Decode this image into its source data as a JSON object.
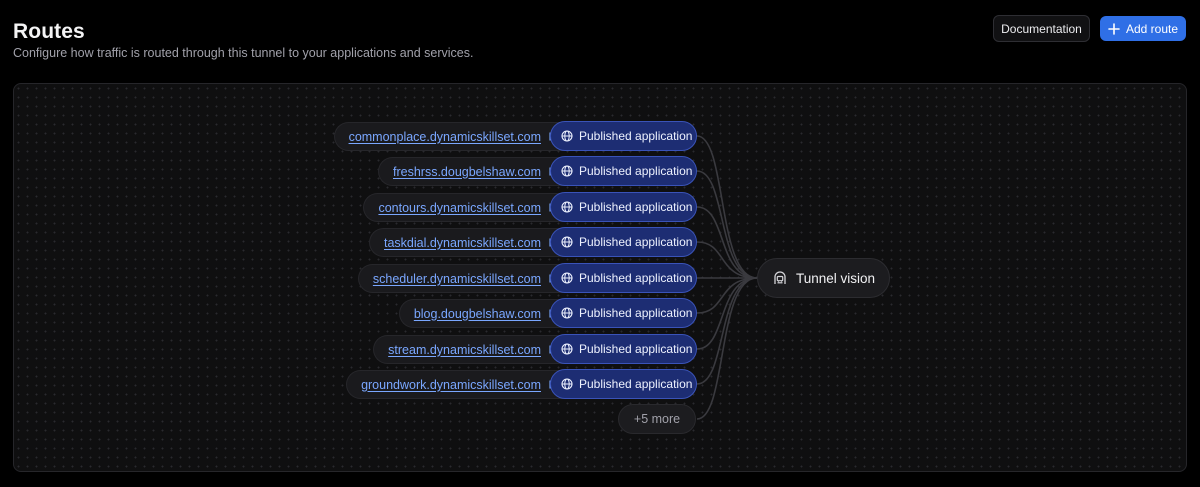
{
  "header": {
    "title": "Routes",
    "subtitle": "Configure how traffic is routed through this tunnel to your applications and services."
  },
  "actions": {
    "documentation_label": "Documentation",
    "add_route_label": "Add route",
    "add_route_icon": "plus-icon"
  },
  "routes": [
    {
      "hostname": "commonplace.dynamicskillset.com",
      "type_label": "Published application"
    },
    {
      "hostname": "freshrss.dougbelshaw.com",
      "type_label": "Published application"
    },
    {
      "hostname": "contours.dynamicskillset.com",
      "type_label": "Published application"
    },
    {
      "hostname": "taskdial.dynamicskillset.com",
      "type_label": "Published application"
    },
    {
      "hostname": "scheduler.dynamicskillset.com",
      "type_label": "Published application"
    },
    {
      "hostname": "blog.dougbelshaw.com",
      "type_label": "Published application"
    },
    {
      "hostname": "stream.dynamicskillset.com",
      "type_label": "Published application"
    },
    {
      "hostname": "groundwork.dynamicskillset.com",
      "type_label": "Published application"
    }
  ],
  "more_label": "+5 more",
  "tunnel": {
    "name": "Tunnel vision",
    "icon": "tunnel-icon"
  },
  "colors": {
    "accent": "#2f6fe6",
    "link": "#7aa7ff",
    "published_pill": "#1d2d73"
  }
}
